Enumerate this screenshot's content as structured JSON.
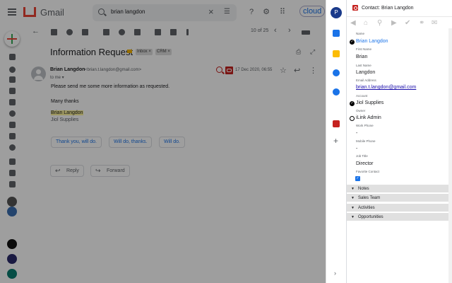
{
  "gmail": {
    "app_name": "Gmail",
    "search_query": "brian langdon",
    "brand_badge": "cloud",
    "pager": "10 of 25",
    "subject": "Information Request",
    "labels": [
      "Inbox ×",
      "CRM ×"
    ],
    "sender_name": "Brian Langdon",
    "sender_email": "<brian.t.langdon@gmail.com>",
    "to_me": "to me ▾",
    "date": "17 Dec 2020, 06:55",
    "body": [
      "Please send me some more information as requested.",
      "Many thanks"
    ],
    "signature_name": "Brian Langdon",
    "signature_company": "Jiol Supplies",
    "smart_replies": [
      "Thank you, will do.",
      "Will do, thanks.",
      "Will do."
    ],
    "reply_label": "Reply",
    "forward_label": "Forward",
    "icons": {
      "menu": "hamburger-icon",
      "search": "search-icon",
      "clear": "close-icon",
      "tune": "tune-icon",
      "help": "help-icon",
      "settings": "gear-icon",
      "apps": "apps-icon",
      "back": "arrow-back-icon",
      "archive": "archive-icon",
      "spam": "report-icon",
      "delete": "trash-icon",
      "mark_unread": "mail-icon",
      "snooze": "clock-icon",
      "add_task": "task-icon",
      "move": "folder-icon",
      "label": "label-icon",
      "more": "more-vert-icon",
      "prev": "chevron-left-icon",
      "next": "chevron-right-icon",
      "density": "keyboard-icon",
      "print": "print-icon",
      "open_new": "open-in-new-icon",
      "star": "star-icon",
      "reply": "reply-icon",
      "more_msg": "more-vert-icon"
    }
  },
  "siderail": {
    "avatar_letter": "P",
    "icons": [
      "calendar-icon",
      "keep-icon",
      "tasks-icon",
      "contacts-icon",
      "crm-addon-icon"
    ],
    "add_icon": "+",
    "expand_icon": "›"
  },
  "panel": {
    "title": "Contact: Brian Langdon",
    "toolbar_icons": [
      "back-icon",
      "home-icon",
      "search-icon",
      "play-icon",
      "check-icon",
      "link-icon",
      "email-icon"
    ],
    "fields": {
      "name_label": "Name",
      "name_value": "Brian Langdon",
      "first_name_label": "First Name",
      "first_name_value": "Brian",
      "last_name_label": "Last Name",
      "last_name_value": "Langdon",
      "email_label": "Email Address",
      "email_value": "brian.t.langdon@gmail.com",
      "account_label": "Account",
      "account_value": "Jiol Supplies",
      "owner_label": "Owner",
      "owner_value": "iLink Admin",
      "work_phone_label": "Work Phone",
      "work_phone_value": "-",
      "mobile_phone_label": "Mobile Phone",
      "mobile_phone_value": "-",
      "job_title_label": "Job Title",
      "job_title_value": "Director",
      "favorite_label": "Favorite Contact",
      "favorite_checked": true
    },
    "sections": [
      "Notes",
      "Sales Team",
      "Activities",
      "Opportunities"
    ]
  },
  "colors": {
    "gmail_red": "#ea4335",
    "link_blue": "#1a73e8",
    "crm_red": "#c5221f",
    "avatar_navy": "#1a3a8a",
    "section_gray": "#e0e0e0"
  }
}
